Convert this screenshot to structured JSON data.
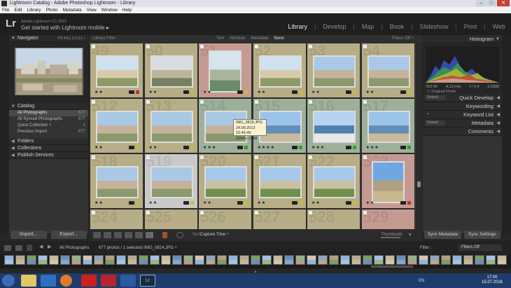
{
  "window": {
    "title": "Lightroom Catalog - Adobe Photoshop Lightroom - Library"
  },
  "menu": [
    "File",
    "Edit",
    "Library",
    "Photo",
    "Metadata",
    "View",
    "Window",
    "Help"
  ],
  "identity": {
    "logo": "Lr",
    "product": "Adobe Lightroom CC 2015",
    "headline": "Get started with Lightroom mobile ▸"
  },
  "modules": [
    "Library",
    "Develop",
    "Map",
    "Book",
    "Slideshow",
    "Print",
    "Web"
  ],
  "active_module": "Library",
  "left_panel": {
    "navigator": {
      "title": "Navigator",
      "zoom": "FIT   FILL   1:1   3:1 ÷"
    },
    "catalog": {
      "title": "Catalog",
      "rows": [
        {
          "label": "All Photographs",
          "count": "677"
        },
        {
          "label": "All Synced Photographs",
          "count": "677"
        },
        {
          "label": "Quick Collection +",
          "count": "1"
        },
        {
          "label": "Previous Import",
          "count": "677"
        }
      ]
    },
    "folders": "Folders",
    "collections": "Collections",
    "publish": "Publish Services",
    "import_btn": "Import...",
    "export_btn": "Export..."
  },
  "filter_bar": {
    "label": "Library Filter :",
    "options": [
      "Text",
      "Attribute",
      "Metadata",
      "None"
    ],
    "selected": "None",
    "filters_off": "Filters Off ÷"
  },
  "grid": {
    "cells": [
      {
        "num": "49",
        "bg": "#b7ad87",
        "stars": "★★",
        "flag": "#c03030",
        "scene": "building"
      },
      {
        "num": "50",
        "bg": "#b7ad87",
        "stars": "★★",
        "flag": "#c0c030",
        "scene": "cloudy"
      },
      {
        "num": "51",
        "bg": "#c59a92",
        "stars": "★★",
        "flag": "#c0c030",
        "scene": "pool"
      },
      {
        "num": "52",
        "bg": "#b7ad87",
        "stars": "★★",
        "flag": "#c0c030",
        "scene": "building"
      },
      {
        "num": "53",
        "bg": "#b7ad87",
        "stars": "★★",
        "flag": "#c0c030",
        "scene": "city"
      },
      {
        "num": "54",
        "bg": "#b7ad87",
        "stars": "★★",
        "flag": "#c0c030",
        "scene": "city"
      },
      {
        "num": "512",
        "bg": "#b7ad87",
        "stars": "★★",
        "flag": "#c0c030",
        "scene": "city"
      },
      {
        "num": "513",
        "bg": "#b7ad87",
        "stars": "★★",
        "flag": "#c0c030",
        "scene": "city"
      },
      {
        "num": "514",
        "bg": "#9fb09a",
        "stars": "★★★",
        "flag": "#30a030",
        "scene": "city"
      },
      {
        "num": "515",
        "bg": "#9fb09a",
        "stars": "★★★★",
        "flag": "#30a030",
        "scene": "sea"
      },
      {
        "num": "516",
        "bg": "#9fb09a",
        "stars": "★★★",
        "flag": "#30a030",
        "scene": "ship"
      },
      {
        "num": "517",
        "bg": "#9fb09a",
        "stars": "★★★",
        "flag": "#30a030",
        "scene": "sea"
      },
      {
        "num": "518",
        "bg": "#b7ad87",
        "stars": "★★",
        "flag": "#c0c030",
        "scene": "city"
      },
      {
        "num": "519",
        "bg": "#c9c9c9",
        "stars": "★★",
        "flag": "#c0c030",
        "scene": "city"
      },
      {
        "num": "520",
        "bg": "#b7ad87",
        "stars": "★★",
        "flag": "#c0c030",
        "scene": "park"
      },
      {
        "num": "521",
        "bg": "#b7ad87",
        "stars": "★★",
        "flag": "#c0c030",
        "scene": "park"
      },
      {
        "num": "522",
        "bg": "#b7ad87",
        "stars": "★★",
        "flag": "#c0c030",
        "scene": "park"
      },
      {
        "num": "523",
        "bg": "#c59a92",
        "stars": "★★",
        "flag": "#c03030",
        "scene": "tower"
      },
      {
        "num": "524",
        "bg": "#b7ad87",
        "stars": "",
        "flag": "",
        "scene": "partial"
      },
      {
        "num": "525",
        "bg": "#b7ad87",
        "stars": "",
        "flag": "",
        "scene": "partial"
      },
      {
        "num": "526",
        "bg": "#b7ad87",
        "stars": "",
        "flag": "",
        "scene": "partial"
      },
      {
        "num": "527",
        "bg": "#b7ad87",
        "stars": "",
        "flag": "",
        "scene": "partial"
      },
      {
        "num": "528",
        "bg": "#b7ad87",
        "stars": "",
        "flag": "",
        "scene": "partial"
      },
      {
        "num": "529",
        "bg": "#c59a92",
        "stars": "",
        "flag": "",
        "scene": "partial"
      }
    ]
  },
  "tooltip": {
    "name": "IMG_0819.JPG",
    "date": "24.08.2013 15:45:49",
    "dims": "3264 x 2448"
  },
  "toolbar": {
    "sort_label": "Sort:",
    "sort_value": "Capture Time ÷",
    "thumbnails_label": "Thumbnails"
  },
  "right_panel": {
    "histogram": "Histogram",
    "hist_meta": [
      "ISO 50",
      "4.13 mm",
      "f / 2.4",
      "1/1900"
    ],
    "original_photo": "Original Photo",
    "quick_develop": "Quick Develop",
    "keywording": "Keywording",
    "keyword_list": "Keyword List",
    "metadata": "Metadata",
    "comments": "Comments",
    "default_label": "Default",
    "sync_metadata": "Sync Metadata",
    "sync_settings": "Sync Settings"
  },
  "filmstrip": {
    "path": "All Photographs",
    "info": "677 photos / 1 selected /IMG_0824.JPG ÷",
    "filter_label": "Filter :",
    "filter_value": "Filters Off"
  },
  "taskbar": {
    "time": "17:00",
    "date": "15.07.2016",
    "lang": "EN"
  }
}
